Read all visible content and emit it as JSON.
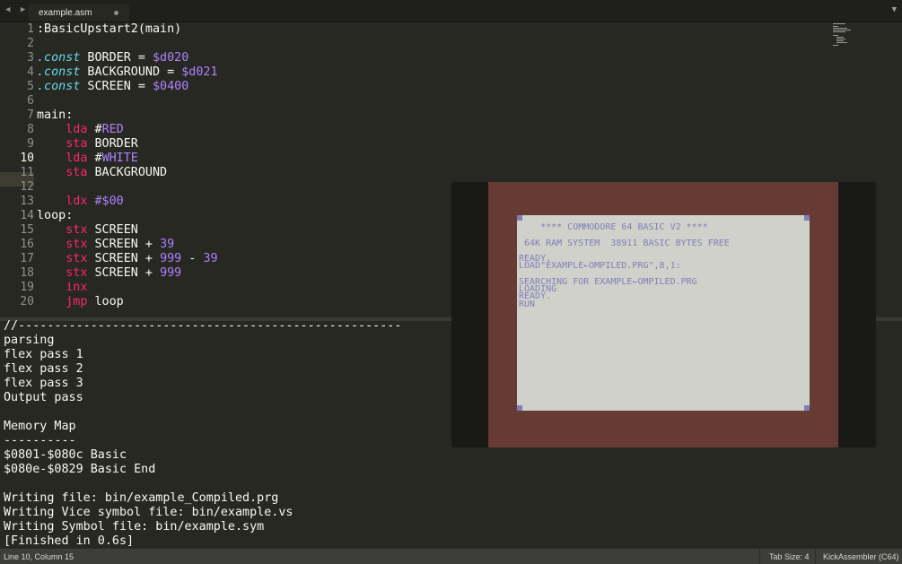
{
  "tab": {
    "filename": "example.asm"
  },
  "editor": {
    "current_line": 10,
    "lines": [
      {
        "n": "1",
        "spans": [
          [
            "plain",
            ":BasicUpstart2(main)"
          ]
        ]
      },
      {
        "n": "2",
        "spans": []
      },
      {
        "n": "3",
        "spans": [
          [
            "kw-const",
            ".const"
          ],
          [
            "plain",
            " BORDER = "
          ],
          [
            "num",
            "$d020"
          ]
        ]
      },
      {
        "n": "4",
        "spans": [
          [
            "kw-const",
            ".const"
          ],
          [
            "plain",
            " BACKGROUND = "
          ],
          [
            "num",
            "$d021"
          ]
        ]
      },
      {
        "n": "5",
        "spans": [
          [
            "kw-const",
            ".const"
          ],
          [
            "plain",
            " SCREEN = "
          ],
          [
            "num",
            "$0400"
          ]
        ]
      },
      {
        "n": "6",
        "spans": []
      },
      {
        "n": "7",
        "spans": [
          [
            "plain",
            "main:"
          ]
        ]
      },
      {
        "n": "8",
        "spans": [
          [
            "plain",
            "    "
          ],
          [
            "kw-op",
            "lda"
          ],
          [
            "plain",
            " #"
          ],
          [
            "num",
            "RED"
          ]
        ]
      },
      {
        "n": "9",
        "spans": [
          [
            "plain",
            "    "
          ],
          [
            "kw-op",
            "sta"
          ],
          [
            "plain",
            " BORDER"
          ]
        ]
      },
      {
        "n": "10",
        "spans": [
          [
            "plain",
            "    "
          ],
          [
            "kw-op",
            "lda"
          ],
          [
            "plain",
            " #"
          ],
          [
            "num",
            "WHITE"
          ]
        ]
      },
      {
        "n": "11",
        "spans": [
          [
            "plain",
            "    "
          ],
          [
            "kw-op",
            "sta"
          ],
          [
            "plain",
            " BACKGROUND"
          ]
        ]
      },
      {
        "n": "12",
        "spans": []
      },
      {
        "n": "13",
        "spans": [
          [
            "plain",
            "    "
          ],
          [
            "kw-op",
            "ldx"
          ],
          [
            "plain",
            " "
          ],
          [
            "num",
            "#$00"
          ]
        ]
      },
      {
        "n": "14",
        "spans": [
          [
            "plain",
            "loop:"
          ]
        ]
      },
      {
        "n": "15",
        "spans": [
          [
            "plain",
            "    "
          ],
          [
            "kw-op",
            "stx"
          ],
          [
            "plain",
            " SCREEN"
          ]
        ]
      },
      {
        "n": "16",
        "spans": [
          [
            "plain",
            "    "
          ],
          [
            "kw-op",
            "stx"
          ],
          [
            "plain",
            " SCREEN + "
          ],
          [
            "num",
            "39"
          ]
        ]
      },
      {
        "n": "17",
        "spans": [
          [
            "plain",
            "    "
          ],
          [
            "kw-op",
            "stx"
          ],
          [
            "plain",
            " SCREEN + "
          ],
          [
            "num",
            "999"
          ],
          [
            "plain",
            " - "
          ],
          [
            "num",
            "39"
          ]
        ]
      },
      {
        "n": "18",
        "spans": [
          [
            "plain",
            "    "
          ],
          [
            "kw-op",
            "stx"
          ],
          [
            "plain",
            " SCREEN + "
          ],
          [
            "num",
            "999"
          ]
        ]
      },
      {
        "n": "19",
        "spans": [
          [
            "plain",
            "    "
          ],
          [
            "kw-op",
            "inx"
          ]
        ]
      },
      {
        "n": "20",
        "spans": [
          [
            "plain",
            "    "
          ],
          [
            "kw-op",
            "jmp"
          ],
          [
            "plain",
            " loop"
          ]
        ]
      }
    ]
  },
  "output": {
    "lines": [
      "//-----------------------------------------------------",
      "parsing",
      "flex pass 1",
      "flex pass 2",
      "flex pass 3",
      "Output pass",
      "",
      "Memory Map",
      "----------",
      "$0801-$080c Basic",
      "$080e-$0829 Basic End",
      "",
      "Writing file: bin/example_Compiled.prg",
      "Writing Vice symbol file: bin/example.vs",
      "Writing Symbol file: bin/example.sym",
      "[Finished in 0.6s]"
    ]
  },
  "emulator": {
    "screen_lines": [
      "    **** COMMODORE 64 BASIC V2 ****",
      "",
      " 64K RAM SYSTEM  38911 BASIC BYTES FREE",
      "",
      "READY.",
      "LOAD\"EXAMPLE←OMPILED.PRG\",8,1:",
      "",
      "SEARCHING FOR EXAMPLE←OMPILED.PRG",
      "LOADING",
      "READY.",
      "RUN"
    ]
  },
  "status": {
    "position": "Line 10, Column 15",
    "tab_size": "Tab Size: 4",
    "syntax": "KickAssembler (C64)"
  },
  "colors": {
    "background": "#272822",
    "keyword": "#f92672",
    "constant": "#66d9ef",
    "number": "#ae81ff",
    "c64_border": "#663b33",
    "c64_screen": "#d1d1cb",
    "c64_text": "#7e7fb8"
  }
}
